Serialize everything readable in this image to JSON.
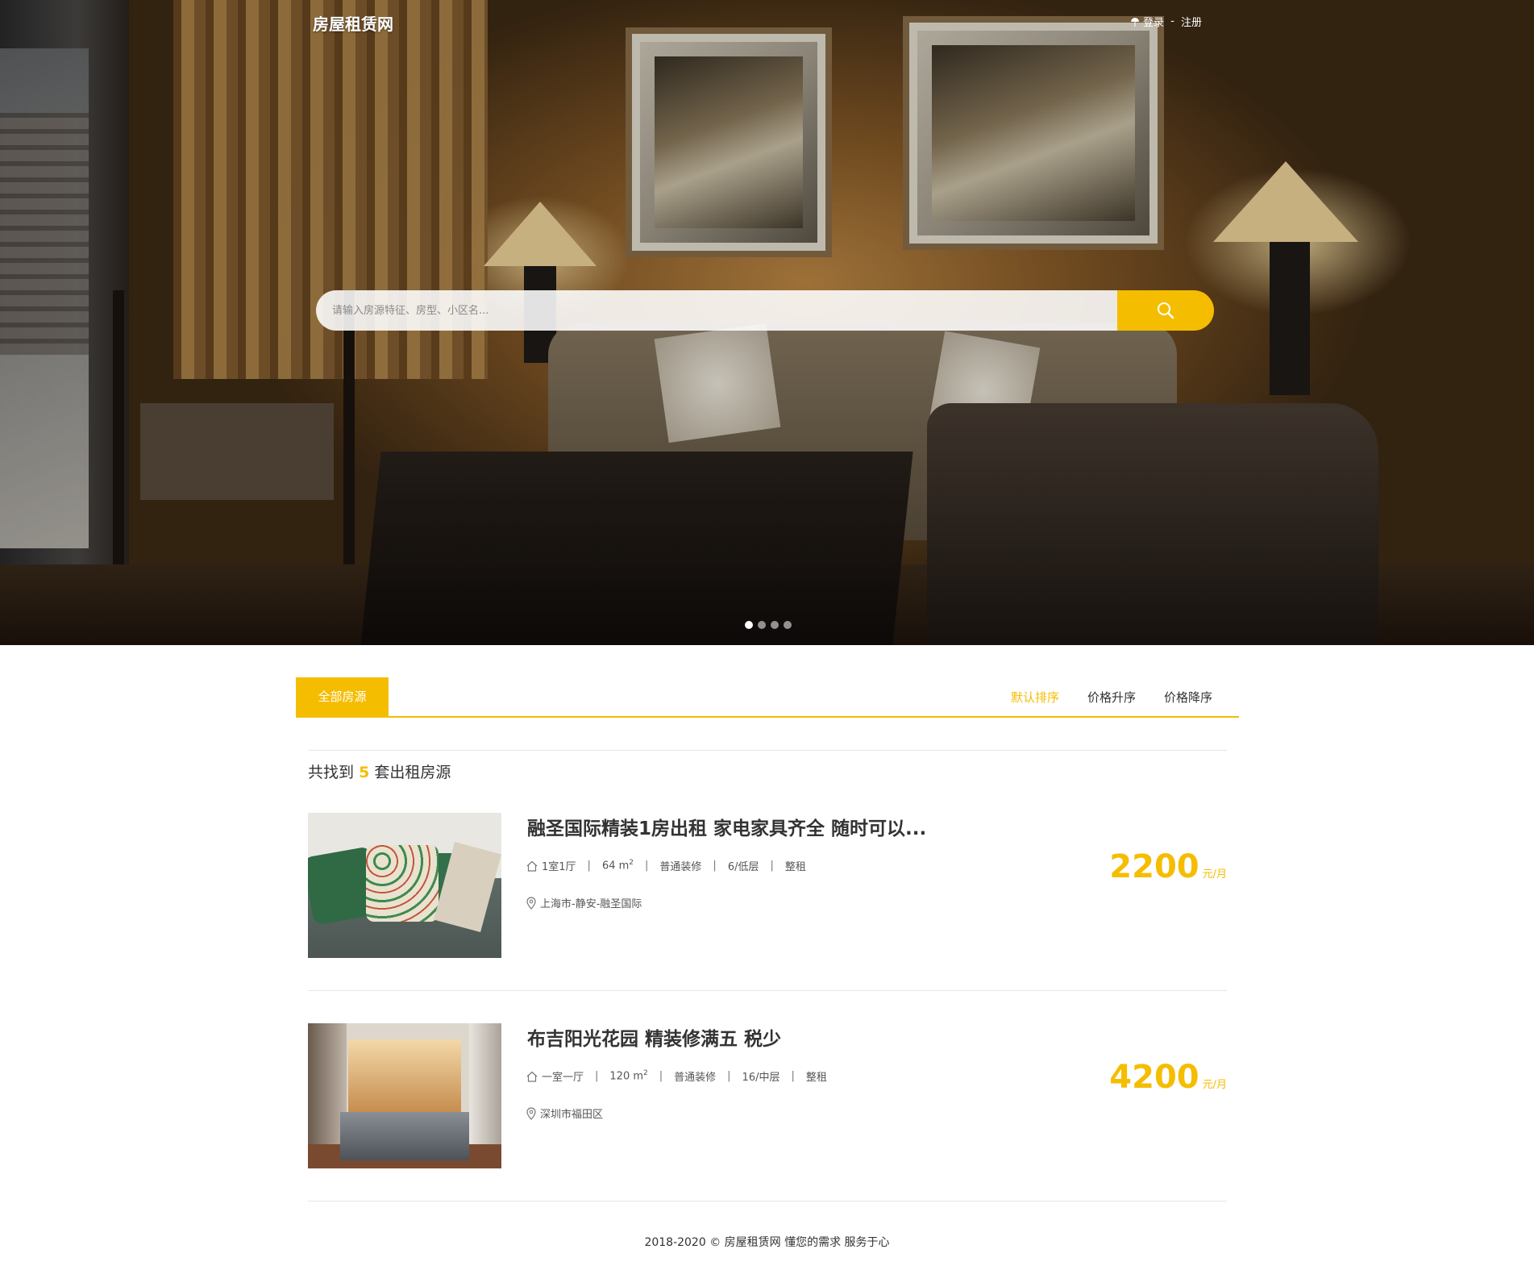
{
  "header": {
    "site_title": "房屋租赁网",
    "login_link": "登录",
    "auth_separator": " - ",
    "register_link": "注册"
  },
  "search": {
    "placeholder": "请输入房源特征、房型、小区名...",
    "button_icon": "search-icon"
  },
  "carousel": {
    "slide_count": 4,
    "active_index": 0
  },
  "tabs": {
    "all_label": "全部房源",
    "sort_options": [
      {
        "label": "默认排序",
        "active": true
      },
      {
        "label": "价格升序",
        "active": false
      },
      {
        "label": "价格降序",
        "active": false
      }
    ]
  },
  "results": {
    "prefix": "共找到",
    "count": "5",
    "suffix": "套出租房源"
  },
  "listings": [
    {
      "title": "融圣国际精装1房出租 家电家具齐全 随时可以...",
      "layout": "1室1厅",
      "area_value": "64 m",
      "area_sup": "2",
      "decoration": "普通装修",
      "floor": "6/低层",
      "rent_type": "整租",
      "location": "上海市-静安-融圣国际",
      "price": "2200",
      "price_unit": "元/月"
    },
    {
      "title": "布吉阳光花园 精装修满五 税少",
      "layout": "一室一厅",
      "area_value": "120 m",
      "area_sup": "2",
      "decoration": "普通装修",
      "floor": "16/中层",
      "rent_type": "整租",
      "location": "深圳市福田区",
      "price": "4200",
      "price_unit": "元/月"
    }
  ],
  "meta_separator": "|",
  "footer": {
    "text": "2018-2020 © 房屋租赁网 懂您的需求 服务于心"
  },
  "colors": {
    "accent": "#f5bd00",
    "text": "#333333"
  }
}
